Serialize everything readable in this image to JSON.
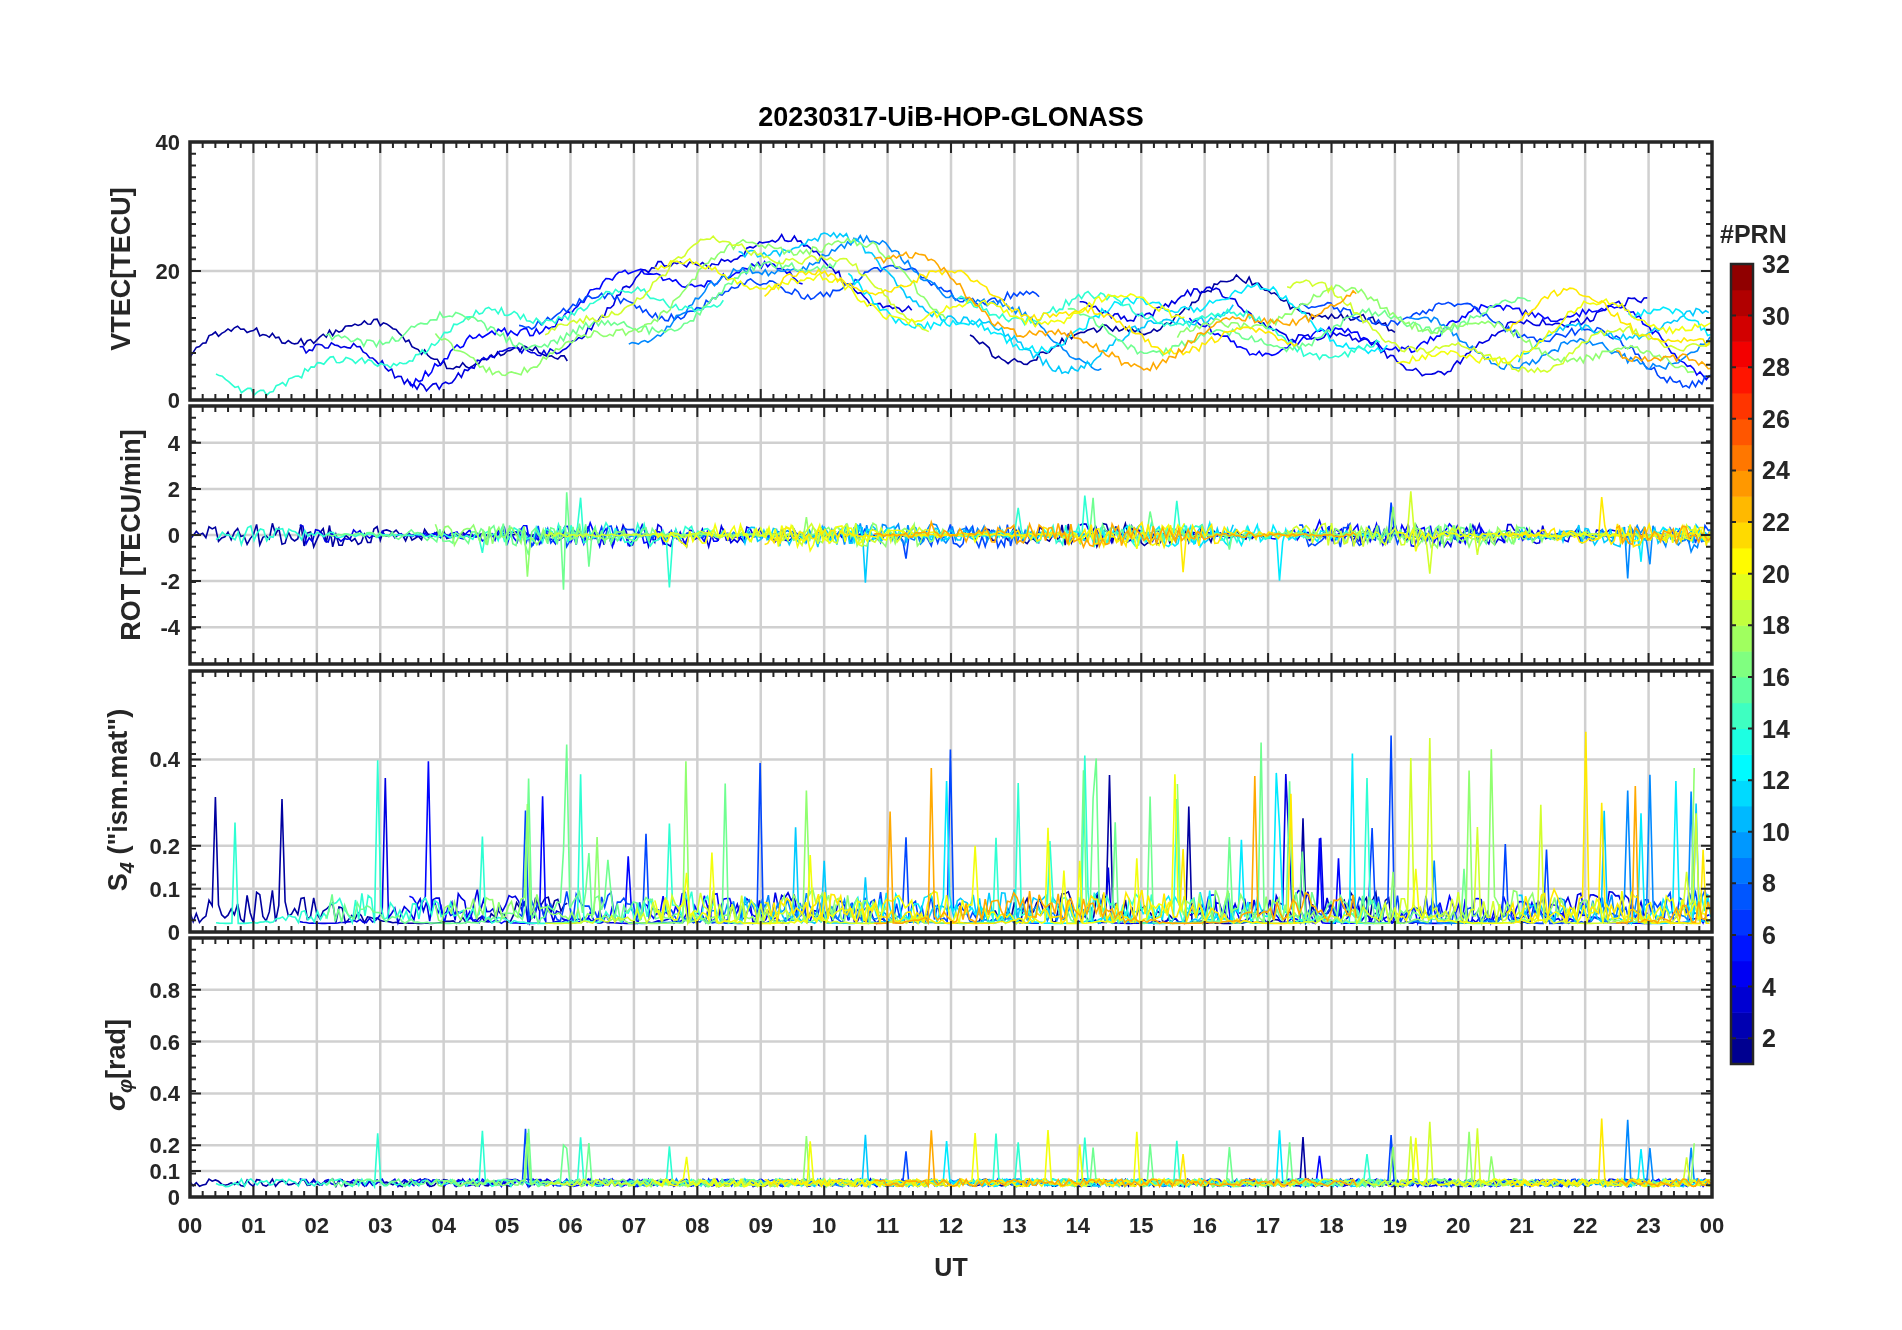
{
  "title": "20230317-UiB-HOP-GLONASS",
  "panels": [
    {
      "kind": "vtec",
      "chart_data": {
        "type": "line",
        "ylabel": "VTEC[TECU]",
        "xlim": [
          0,
          24
        ],
        "ylim": [
          0,
          40
        ],
        "yticks": [
          0,
          20,
          40
        ]
      }
    },
    {
      "kind": "rot",
      "chart_data": {
        "type": "line",
        "ylabel": "ROT [TECU/min]",
        "xlim": [
          0,
          24
        ],
        "ylim": [
          -5.6,
          5.6
        ],
        "yticks": [
          -4,
          -2,
          0,
          2,
          4
        ]
      }
    },
    {
      "kind": "s4",
      "chart_data": {
        "type": "line",
        "ylabel": "S$_{4}$ (\"ism.mat\")",
        "xlim": [
          0,
          24
        ],
        "ylim": [
          0,
          0.605
        ],
        "yticks": [
          0,
          0.1,
          0.2,
          0.4
        ]
      }
    },
    {
      "kind": "phase",
      "chart_data": {
        "type": "line",
        "ylabel": "*σ*$_{φ}$[rad]",
        "xlabel": "UT",
        "xlim": [
          0,
          24
        ],
        "ylim": [
          0,
          1
        ],
        "yticks": [
          0,
          0.1,
          0.2,
          0.4,
          0.6,
          0.8
        ],
        "xticks": [
          {
            "value": 0,
            "label": "00"
          },
          {
            "value": 1,
            "label": "01"
          },
          {
            "value": 2,
            "label": "02"
          },
          {
            "value": 3,
            "label": "03"
          },
          {
            "value": 4,
            "label": "04"
          },
          {
            "value": 5,
            "label": "05"
          },
          {
            "value": 6,
            "label": "06"
          },
          {
            "value": 7,
            "label": "07"
          },
          {
            "value": 8,
            "label": "08"
          },
          {
            "value": 9,
            "label": "09"
          },
          {
            "value": 10,
            "label": "10"
          },
          {
            "value": 11,
            "label": "11"
          },
          {
            "value": 12,
            "label": "12"
          },
          {
            "value": 13,
            "label": "13"
          },
          {
            "value": 14,
            "label": "14"
          },
          {
            "value": 15,
            "label": "15"
          },
          {
            "value": 16,
            "label": "16"
          },
          {
            "value": 17,
            "label": "17"
          },
          {
            "value": 18,
            "label": "18"
          },
          {
            "value": 19,
            "label": "19"
          },
          {
            "value": 20,
            "label": "20"
          },
          {
            "value": 21,
            "label": "21"
          },
          {
            "value": 22,
            "label": "22"
          },
          {
            "value": 23,
            "label": "23"
          },
          {
            "value": 24,
            "label": "00"
          }
        ]
      }
    }
  ],
  "colorbar": {
    "title": "#PRN",
    "ticks": [
      "32",
      "30",
      "28",
      "26",
      "24",
      "22",
      "20",
      "18",
      "16",
      "14",
      "12",
      "10",
      "8",
      "6",
      "4",
      "2"
    ]
  }
}
